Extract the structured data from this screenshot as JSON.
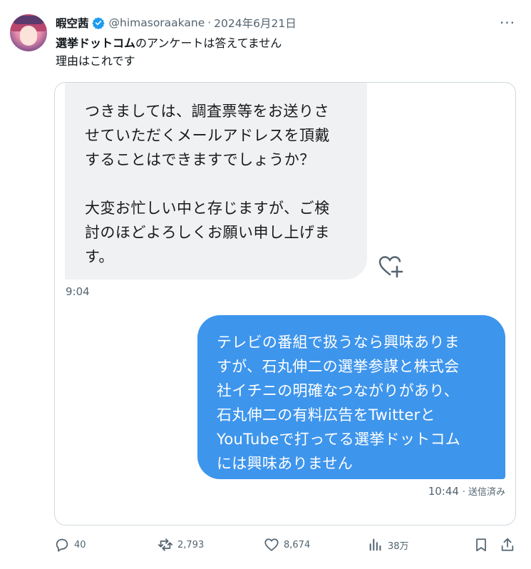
{
  "post": {
    "author_name": "暇空茜",
    "handle": "@himasoraakane",
    "separator": "·",
    "date": "2024年6月21日",
    "more_label": "···",
    "text_bold": "選挙ドットコム",
    "text_line1_rest": "のアンケートは答えてません",
    "text_line2": "理由はこれです"
  },
  "chat": {
    "incoming_lines": [
      "つきましては、調査票等をお送りさ",
      "せていただくメールアドレスを頂戴",
      "することはできますでしょうか？",
      "",
      "大変お忙しい中と存じますが、ご検",
      "討のほどよろしくお願い申し上げま",
      "す。"
    ],
    "incoming_time": "9:04",
    "outgoing_lines": [
      "テレビの番組で扱うなら興味ありま",
      "すが、石丸伸二の選挙参謀と株式会",
      "社イチニの明確なつながりがあり、",
      "石丸伸二の有料広告をTwitterと",
      "YouTubeで打ってる選挙ドットコム",
      "には興味ありません"
    ],
    "outgoing_time": "10:44",
    "outgoing_status": "· 送信済み"
  },
  "actions": {
    "replies": "40",
    "reposts": "2,793",
    "likes": "8,674",
    "views": "38万"
  },
  "colors": {
    "verified": "#1d9bf0",
    "bubble_in": "#eff1f3",
    "bubble_out": "#3e95ec",
    "muted": "#536471"
  }
}
